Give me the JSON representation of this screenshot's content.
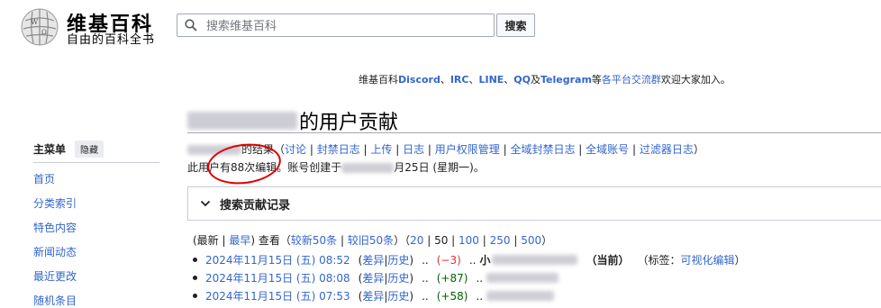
{
  "header": {
    "wordmark": "维基百科",
    "tagline": "自由的百科全书",
    "search_placeholder": "搜索维基百科",
    "search_button": "搜索"
  },
  "sitenotice": {
    "prefix": "维基百科",
    "discord": "Discord",
    "sep1": "、",
    "irc": "IRC",
    "sep2": "、",
    "line": "LINE",
    "sep3": "、",
    "qq": "QQ",
    "and": "及",
    "telegram": "Telegram",
    "mid": "等",
    "groups": "各平台交流群",
    "suffix": "欢迎大家加入。"
  },
  "sidebar": {
    "title": "主菜单",
    "hide": "隐藏",
    "items": [
      {
        "label": "首页"
      },
      {
        "label": "分类索引"
      },
      {
        "label": "特色内容"
      },
      {
        "label": "新闻动态"
      },
      {
        "label": "最近更改"
      },
      {
        "label": "随机条目"
      }
    ]
  },
  "page": {
    "heading_suffix": "的用户贡献",
    "sub1": {
      "results": "的结果",
      "open": "（",
      "links": [
        "讨论",
        "封禁日志",
        "上传",
        "日志",
        "用户权限管理",
        "全域封禁日志",
        "全域账号",
        "过滤器日志"
      ],
      "sep": " | ",
      "close": "）"
    },
    "sub2": {
      "edit_count": "此用户有88次编辑。",
      "created_prefix": "账号创建于",
      "created_suffix": "月25日 (星期一)。"
    },
    "panel_title": "搜索贡献记录",
    "nav": {
      "latest": "(最新 | ",
      "earliest": "最早",
      "view": ") 查看（",
      "newer": "较新50条",
      "sep": " | ",
      "older": "较旧50条",
      "close": "）（",
      "limits": [
        "20",
        "50",
        "100",
        "250",
        "500"
      ],
      "end": "）"
    },
    "rows": [
      {
        "date": "2024年11月15日 (五) 08:52",
        "diff": "差异",
        "hist": "历史",
        "dots": "..",
        "size": "(−3)",
        "size_color": "#dd3333",
        "dots2": "..",
        "prefix": "小",
        "current": "（当前）",
        "tags": "（标签：",
        "tag": "可视化编辑",
        "tags_end": "）"
      },
      {
        "date": "2024年11月15日 (五) 08:08",
        "diff": "差异",
        "hist": "历史",
        "dots": "..",
        "size": "(+87)",
        "size_color": "#006400",
        "dots2": ".."
      },
      {
        "date": "2024年11月15日 (五) 07:53",
        "diff": "差异",
        "hist": "历史",
        "dots": "..",
        "size": "(+58)",
        "size_color": "#006400",
        "dots2": ".."
      }
    ]
  },
  "icons": {
    "logo": "wikipedia-globe-icon",
    "search": "search-icon",
    "chevron": "chevron-down-icon"
  }
}
